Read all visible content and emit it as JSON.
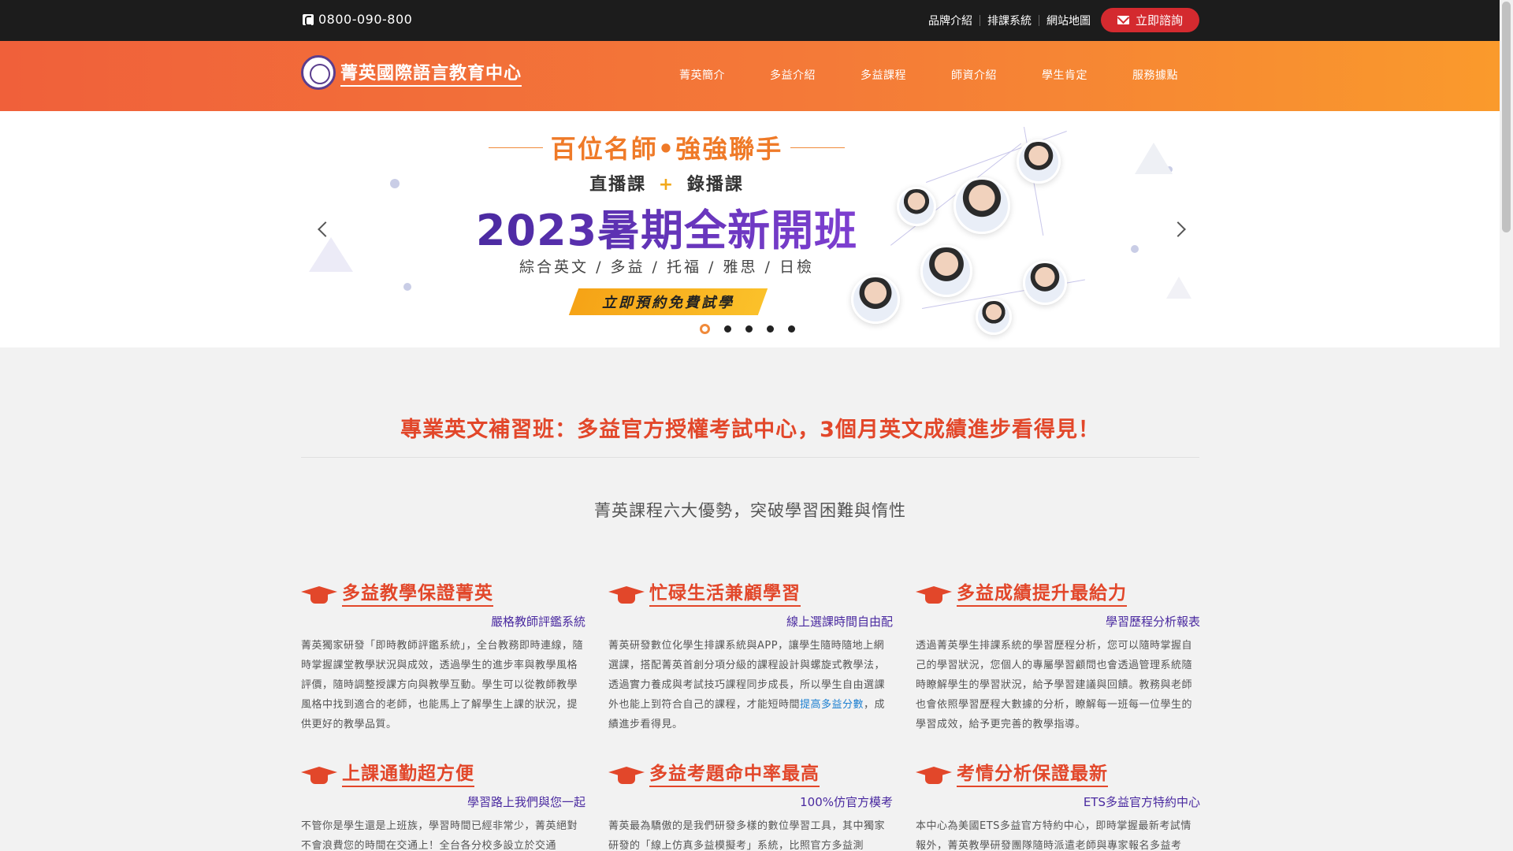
{
  "topbar": {
    "phone": "0800-090-800",
    "links": [
      "品牌介紹",
      "排課系統",
      "網站地圖"
    ],
    "consult_label": "立即諮詢"
  },
  "header": {
    "logo_text": "菁英國際語言教育中心",
    "nav": [
      "菁英簡介",
      "多益介紹",
      "多益課程",
      "師資介紹",
      "學生肯定",
      "服務據點"
    ]
  },
  "hero": {
    "title": "百位名師•強強聯手",
    "sub_left": "直播課",
    "sub_plus": "+",
    "sub_right": "錄播課",
    "big": "2023暑期全新開班",
    "subjects": "綜合英文 / 多益 / 托福 / 雅思 / 日檢",
    "cta": "立即預約免費試學",
    "slide_count": 5,
    "active_slide": 1
  },
  "content": {
    "headline": "專業英文補習班：多益官方授權考試中心，3個月英文成績進步看得見！",
    "subhead": "菁英課程六大優勢，突破學習困難與惰性",
    "features": [
      {
        "title": "多益教學保證菁英",
        "sub": "嚴格教師評鑑系統",
        "body": "菁英獨家研發「即時教師評鑑系統」，全台教務即時連線，隨時掌握課堂教學狀況與成效，透過學生的進步率與教學風格評價，隨時調整授課方向與教學互動。學生可以從教師教學風格中找到適合的老師，也能馬上了解學生上課的狀況，提供更好的教學品質。"
      },
      {
        "title": "忙碌生活兼顧學習",
        "sub": "線上選課時間自由配",
        "body_pre": "菁英研發數位化學生排課系統與APP，讓學生隨時隨地上網選課，搭配菁英首創分項分級的課程設計與螺旋式教學法，透過實力養成與考試技巧課程同步成長，所以學生自由選課外也能上到符合自己的課程，才能短時間",
        "body_link": "提高多益分數",
        "body_post": "，成績進步看得見。"
      },
      {
        "title": "多益成績提升最給力",
        "sub": "學習歷程分析報表",
        "body": "透過菁英學生排課系統的學習歷程分析，您可以隨時掌握自己的學習狀況，您個人的專屬學習顧問也會透過管理系統隨時瞭解學生的學習狀況，給予學習建議與回饋。教務與老師也會依照學習歷程大數據的分析，瞭解每一班每一位學生的學習成效，給予更完善的教學指導。"
      },
      {
        "title": "上課通勤超方便",
        "sub": "學習路上我們與您一起",
        "body": "不管你是學生還是上班族，學習時間已經非常少，菁英絕對不會浪費您的時間在交通上！全台各分校多設立於交通"
      },
      {
        "title": "多益考題命中率最高",
        "sub": "100%仿官方模考",
        "body": "菁英最為驕傲的是我們研發多樣的數位學習工具，其中獨家研發的「線上仿真多益模擬考」系統，比照官方多益測"
      },
      {
        "title": "考情分析保證最新",
        "sub": "ETS多益官方特約中心",
        "body": "本中心為美國ETS多益官方特約中心，即時掌握最新考試情報外，菁英教學研發團隊隨時派遣老師與專家報名多益考"
      }
    ]
  },
  "colors": {
    "accent_red": "#e2472a",
    "accent_orange": "#f47a38",
    "purple": "#4a2aa0",
    "consult_red": "#d42a2f"
  }
}
